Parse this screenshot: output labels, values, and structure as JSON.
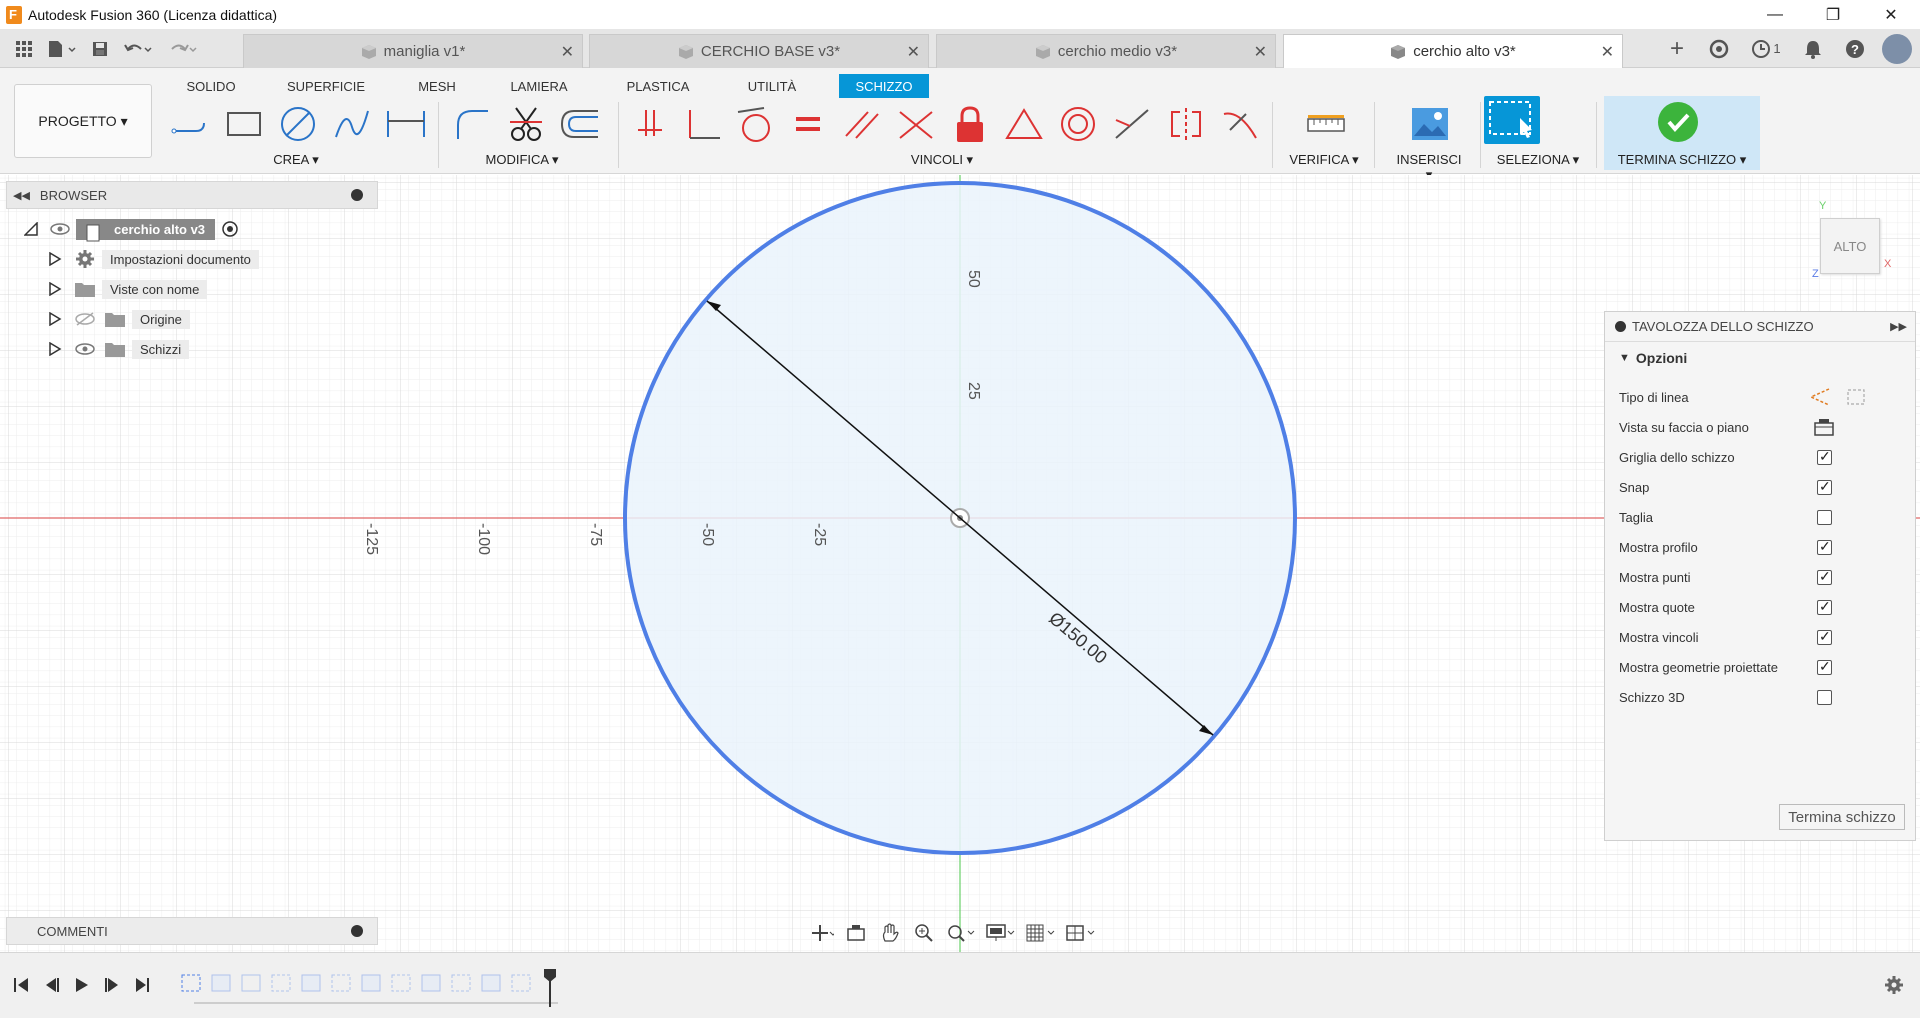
{
  "window": {
    "title": "Autodesk Fusion 360 (Licenza didattica)",
    "minimize": "—",
    "restore": "❐",
    "close": "✕"
  },
  "tabs": [
    {
      "label": "maniglia v1*",
      "active": false
    },
    {
      "label": "CERCHIO BASE v3*",
      "active": false
    },
    {
      "label": "cerchio medio v3*",
      "active": false
    },
    {
      "label": "cerchio alto v3*",
      "active": true
    }
  ],
  "topbar": {
    "jobs_count": "1"
  },
  "ribbon": {
    "project": "PROGETTO ▾",
    "tabs": [
      "SOLIDO",
      "SUPERFICIE",
      "MESH",
      "LAMIERA",
      "PLASTICA",
      "UTILITÀ",
      "SCHIZZO"
    ],
    "active_tab": "SCHIZZO",
    "groups": {
      "crea": "CREA ▾",
      "modifica": "MODIFICA ▾",
      "vincoli": "VINCOLI ▾",
      "verifica": "VERIFICA ▾",
      "inserisci": "INSERISCI ▾",
      "seleziona": "SELEZIONA ▾",
      "termina": "TERMINA SCHIZZO ▾"
    },
    "colors": {
      "accent": "#0696d7",
      "finish": "#3cb43c"
    }
  },
  "browser": {
    "title": "BROWSER",
    "root": "cerchio alto v3",
    "items": [
      {
        "label": "Impostazioni documento",
        "icon": "gear-icon"
      },
      {
        "label": "Viste con nome",
        "icon": "folder-icon"
      },
      {
        "label": "Origine",
        "icon": "folder-icon"
      },
      {
        "label": "Schizzi",
        "icon": "folder-icon"
      }
    ]
  },
  "comments": {
    "title": "COMMENTI"
  },
  "viewcube": {
    "label": "ALTO",
    "axis_x": "X",
    "axis_y": "Y",
    "axis_z": "Z"
  },
  "sketch": {
    "dimension": "Ø150.00",
    "ruler_x": [
      "-125",
      "-100",
      "-75",
      "-50",
      "-25"
    ],
    "ruler_y": [
      "50",
      "25"
    ],
    "circle_color": "#4f7fe6",
    "fill_color": "#eaf3fb"
  },
  "palette": {
    "title": "TAVOLOZZA DELLO SCHIZZO",
    "section": "Opzioni",
    "rows": [
      {
        "label": "Tipo di linea",
        "type": "icons"
      },
      {
        "label": "Vista su faccia o piano",
        "type": "icon"
      },
      {
        "label": "Griglia dello schizzo",
        "checked": true
      },
      {
        "label": "Snap",
        "checked": true
      },
      {
        "label": "Taglia",
        "checked": false
      },
      {
        "label": "Mostra profilo",
        "checked": true
      },
      {
        "label": "Mostra punti",
        "checked": true
      },
      {
        "label": "Mostra quote",
        "checked": true
      },
      {
        "label": "Mostra vincoli",
        "checked": true
      },
      {
        "label": "Mostra geometrie proiettate",
        "checked": true
      },
      {
        "label": "Schizzo 3D",
        "checked": false
      }
    ],
    "finish_button": "Termina schizzo"
  }
}
